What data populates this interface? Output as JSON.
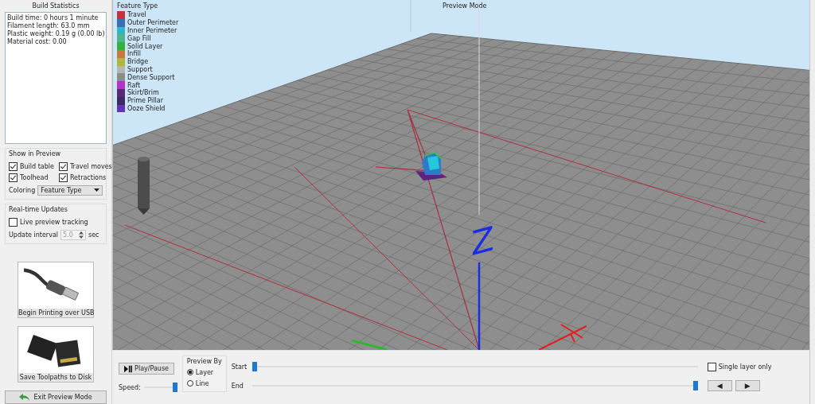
{
  "sidebar": {
    "title": "Build Statistics",
    "stats": [
      "Build time: 0 hours 1 minute",
      "Filament length: 63.0 mm",
      "Plastic weight: 0.19 g (0.00 lb)",
      "Material cost: 0.00"
    ],
    "show_in_preview": {
      "title": "Show in Preview",
      "options": [
        {
          "label": "Build table",
          "checked": true
        },
        {
          "label": "Travel moves",
          "checked": true
        },
        {
          "label": "Toolhead",
          "checked": true
        },
        {
          "label": "Retractions",
          "checked": true
        }
      ],
      "coloring_label": "Coloring",
      "coloring_value": "Feature Type"
    },
    "realtime": {
      "title": "Real-time Updates",
      "live_tracking": {
        "label": "Live preview tracking",
        "checked": false
      },
      "interval_label": "Update interval",
      "interval_value": "5.0",
      "interval_disabled": true,
      "interval_unit": "sec"
    },
    "actions": [
      {
        "kind": "usb",
        "label": "Begin Printing over USB"
      },
      {
        "kind": "sd",
        "label": "Save Toolpaths to Disk"
      }
    ],
    "exit_button": "Exit Preview Mode"
  },
  "viewport": {
    "title": "Preview Mode",
    "legend_title": "Feature Type",
    "axis_label": "Z",
    "legend": [
      {
        "label": "Travel",
        "color": "#c8323c"
      },
      {
        "label": "Outer Perimeter",
        "color": "#3c6eb4"
      },
      {
        "label": "Inner Perimeter",
        "color": "#32b4c8"
      },
      {
        "label": "Gap Fill",
        "color": "#50b48c"
      },
      {
        "label": "Solid Layer",
        "color": "#32b43c"
      },
      {
        "label": "Infill",
        "color": "#c8783c"
      },
      {
        "label": "Bridge",
        "color": "#b4b43c"
      },
      {
        "label": "Support",
        "color": "#b4b4b4"
      },
      {
        "label": "Dense Support",
        "color": "#8c8c8c"
      },
      {
        "label": "Raft",
        "color": "#b432c8"
      },
      {
        "label": "Skirt/Brim",
        "color": "#5a2878"
      },
      {
        "label": "Prime Pillar",
        "color": "#3c2864"
      },
      {
        "label": "Ooze Shield",
        "color": "#6432b4"
      }
    ]
  },
  "controls": {
    "play_pause": "Play/Pause",
    "speed_label": "Speed:",
    "speed": {
      "level": 1.0
    },
    "preview_by": {
      "title": "Preview By",
      "options": [
        {
          "label": "Layer",
          "selected": true
        },
        {
          "label": "Line",
          "selected": false
        }
      ]
    },
    "start_label": "Start",
    "start": {
      "level": 0.0
    },
    "end_label": "End",
    "end": {
      "level": 1.0
    },
    "single_layer": {
      "label": "Single layer only",
      "checked": false
    },
    "nav_buttons": [
      "◀",
      "▶"
    ]
  }
}
